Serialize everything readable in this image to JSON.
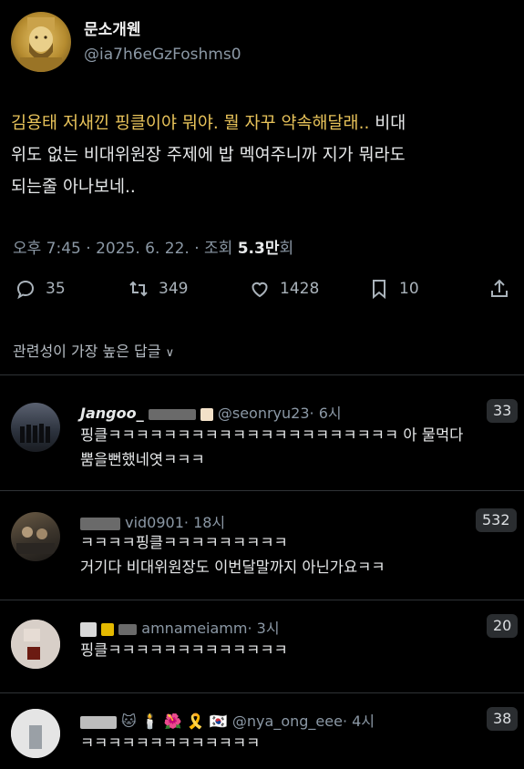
{
  "post": {
    "author_name": "문소개웬",
    "author_handle": "@ia7h6eGzFoshms0",
    "text_highlight": "김용태 저새낀 핑클이야 뭐야. 뭘 자꾸 약속해달래..",
    "text_rest_1": " 비대",
    "text_line2": "위도 없는 비대위원장 주제에 밥 멕여주니까 지가 뭐라도",
    "text_line3": "되는줄 아나보네..",
    "time": "오후 7:45 · 2025. 6. 22. · 조회 ",
    "views": "5.3만",
    "views_suffix": "회",
    "replies": "35",
    "reposts": "349",
    "likes": "1428",
    "bookmarks": "10"
  },
  "sort_label": "관련성이 가장 높은 답글",
  "replies": [
    {
      "name": "Jangoo_",
      "handle": "@seonryu23",
      "time": "· 6시",
      "count": "33",
      "line1": "핑클ㅋㅋㅋㅋㅋㅋㅋㅋㅋㅋㅋㅋㅋㅋㅋㅋㅋㅋㅋㅋㅋ 아 물먹다",
      "line2": "뿜을뻔했네엿ㅋㅋㅋ"
    },
    {
      "handle": "vid0901",
      "time": "· 18시",
      "count": "532",
      "line1": "ㅋㅋㅋㅋ핑클ㅋㅋㅋㅋㅋㅋㅋㅋㅋ",
      "line2": "거기다 비대위원장도 이번달말까지 아닌가요ㅋㅋ"
    },
    {
      "handle": "amnameiamm",
      "time": "· 3시",
      "count": "20",
      "line1": "핑클ㅋㅋㅋㅋㅋㅋㅋㅋㅋㅋㅋㅋㅋ"
    },
    {
      "emoji": "🐱 🕯️ 🌺 🎗️ 🇰🇷",
      "handle": "@nya_ong_eee",
      "time": "· 4시",
      "count": "38",
      "line1": "ㅋㅋㅋㅋㅋㅋㅋㅋㅋㅋㅋㅋㅋ"
    }
  ]
}
